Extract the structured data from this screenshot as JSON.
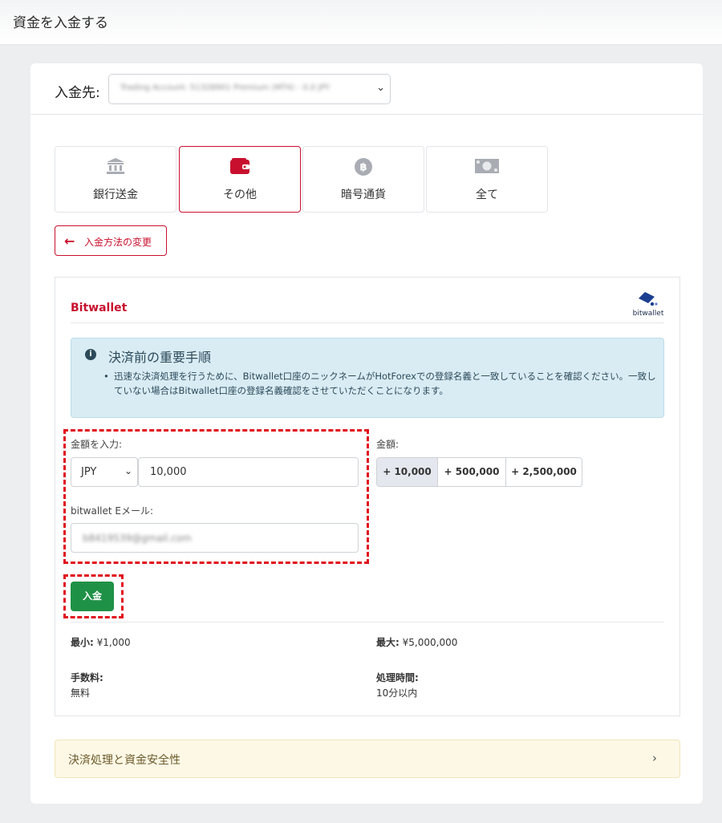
{
  "page": {
    "title": "資金を入金する"
  },
  "destination": {
    "label": "入金先:",
    "selected_value": "Trading Account: 51328901 Premium (MT4) - 0.0 JPY"
  },
  "method_tabs": [
    {
      "label": "銀行送金",
      "icon": "bank-icon",
      "active": false
    },
    {
      "label": "その他",
      "icon": "wallet-icon",
      "active": true
    },
    {
      "label": "暗号通貨",
      "icon": "bitcoin-icon",
      "active": false
    },
    {
      "label": "全て",
      "icon": "cash-icon",
      "active": false
    }
  ],
  "change_method": {
    "label": "入金方法の変更",
    "icon": "arrow-left-icon"
  },
  "panel": {
    "title": "Bitwallet",
    "logo_text": "bitwallet",
    "info": {
      "title": "決済前の重要手順",
      "text": "迅速な決済処理を行うために、Bitwallet口座のニックネームがHotForexでの登録名義と一致していることを確認ください。一致していない場合はBitwallet口座の登録名義確認をさせていただくことになります。"
    },
    "form": {
      "amount_label": "金額を入力:",
      "currency": "JPY",
      "amount_value": "10,000",
      "email_label": "bitwallet Eメール:",
      "email_value": "b8419539@gmail.com",
      "submit_label": "入金"
    },
    "quick_amounts": {
      "label": "金額:",
      "options": [
        "+ 10,000",
        "+ 500,000",
        "+ 2,500,000"
      ],
      "selected_index": 0
    },
    "stats": {
      "min_label": "最小:",
      "min_value": "¥1,000",
      "max_label": "最大:",
      "max_value": "¥5,000,000",
      "fee_label": "手数料:",
      "fee_value": "無料",
      "time_label": "処理時間:",
      "time_value": "10分以内"
    }
  },
  "accordion": {
    "label": "決済処理と資金安全性"
  },
  "colors": {
    "accent": "#c8102e",
    "submit": "#1f9147",
    "info_bg": "#d9ecf4",
    "highlight_dash": "#e0101c",
    "accordion_bg": "#fdf8e6"
  }
}
